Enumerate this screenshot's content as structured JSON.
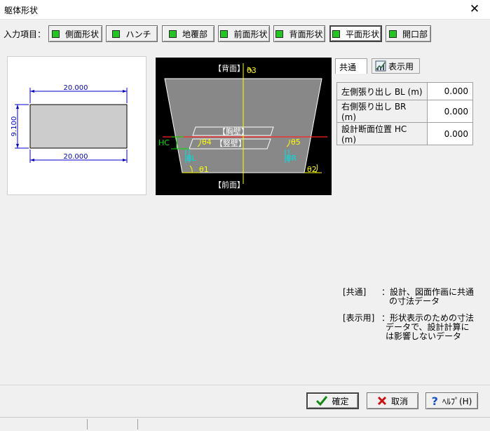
{
  "window": {
    "title": "躯体形状",
    "close_glyph": "✕"
  },
  "inputs": {
    "label": "入力項目：",
    "tabs": [
      "側面形状",
      "ハンチ",
      "地覆部",
      "前面形状",
      "背面形状",
      "平面形状",
      "開口部"
    ],
    "active": "平面形状"
  },
  "side_view": {
    "top_width": "20.000",
    "bottom_width": "20.000",
    "height": "9.100"
  },
  "plan_view": {
    "back": "【背面】",
    "front": "【前面】",
    "parapet": "【胸壁】",
    "wall": "【竪壁】",
    "hc": "HC",
    "bl": "BL",
    "br": "BR",
    "theta1": "θ1",
    "theta2": "θ2",
    "theta3": "θ3",
    "theta4": "θ4",
    "theta5": "θ5"
  },
  "panel_tabs": {
    "common": "共通",
    "display": "表示用"
  },
  "params": [
    {
      "label": "左側張り出し BL (m)",
      "value": "0.000"
    },
    {
      "label": "右側張り出し BR (m)",
      "value": "0.000"
    },
    {
      "label": "設計断面位置 HC (m)",
      "value": "0.000"
    }
  ],
  "notes": {
    "common_key": "[共通]",
    "common_desc": [
      "：設計、図面作画に共通",
      "の寸法データ"
    ],
    "display_key": "[表示用]",
    "display_desc": [
      "：形状表示のための寸法",
      "データで、設計計算に",
      "は影響しないデータ"
    ]
  },
  "buttons": {
    "ok": "確定",
    "cancel": "取消",
    "help": "ﾍﾙﾌﾟ(H)"
  },
  "colors": {
    "tab_indicator": "#22c522",
    "plan_bg": "#000000",
    "dimension": "#0000cc"
  }
}
